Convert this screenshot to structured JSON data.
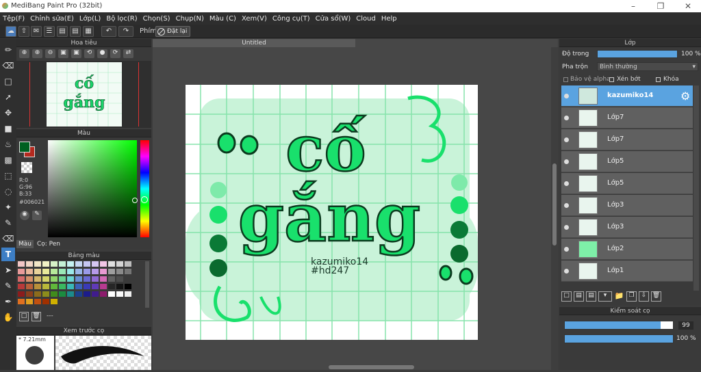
{
  "app": {
    "title": "MediBang Paint Pro (32bit)"
  },
  "menu": [
    "Tệp(F)",
    "Chỉnh sửa(E)",
    "Lớp(L)",
    "Bộ lọc(R)",
    "Chọn(S)",
    "Chụp(N)",
    "Màu (C)",
    "Xem(V)",
    "Công cụ(T)",
    "Cửa sổ(W)",
    "Cloud",
    "Help"
  ],
  "toolbar": {
    "key_label": "Phím",
    "reset_label": "Đặt lại"
  },
  "navigator": {
    "title": "Hoa tiêu"
  },
  "color": {
    "title": "Màu",
    "r": "R:0",
    "g": "G:96",
    "b": "B:33",
    "hex": "#006021",
    "primary": "#006021",
    "secondary": "#c0392b",
    "tab_color": "Màu",
    "tab_brush": "Cọ: Pen"
  },
  "palette": {
    "title": "Bảng màu",
    "extra": "---"
  },
  "brush_preview": {
    "title": "Xem trước cọ",
    "size": "* 7.21mm"
  },
  "canvas": {
    "tab": "Untitled",
    "word1": "cố",
    "word2": "gắng",
    "signature1": "kazumiko14",
    "signature2": "#hd247"
  },
  "layers": {
    "title": "Lớp",
    "opacity_label": "Độ trong",
    "opacity_value": "100 %",
    "blend_label": "Pha trộn",
    "blend_value": "Bình thường",
    "protect_alpha": "Bảo vệ alpha",
    "clip": "Xén bớt",
    "lock": "Khóa",
    "items": [
      {
        "name": "kazumiko14"
      },
      {
        "name": "Lớp7"
      },
      {
        "name": "Lớp7"
      },
      {
        "name": "Lớp5"
      },
      {
        "name": "Lớp5"
      },
      {
        "name": "Lớp3"
      },
      {
        "name": "Lớp3"
      },
      {
        "name": "Lớp2"
      },
      {
        "name": "Lớp1"
      }
    ]
  },
  "brush_control": {
    "title": "Kiểm soát cọ",
    "size_value": "99",
    "opacity_value": "100 %"
  }
}
